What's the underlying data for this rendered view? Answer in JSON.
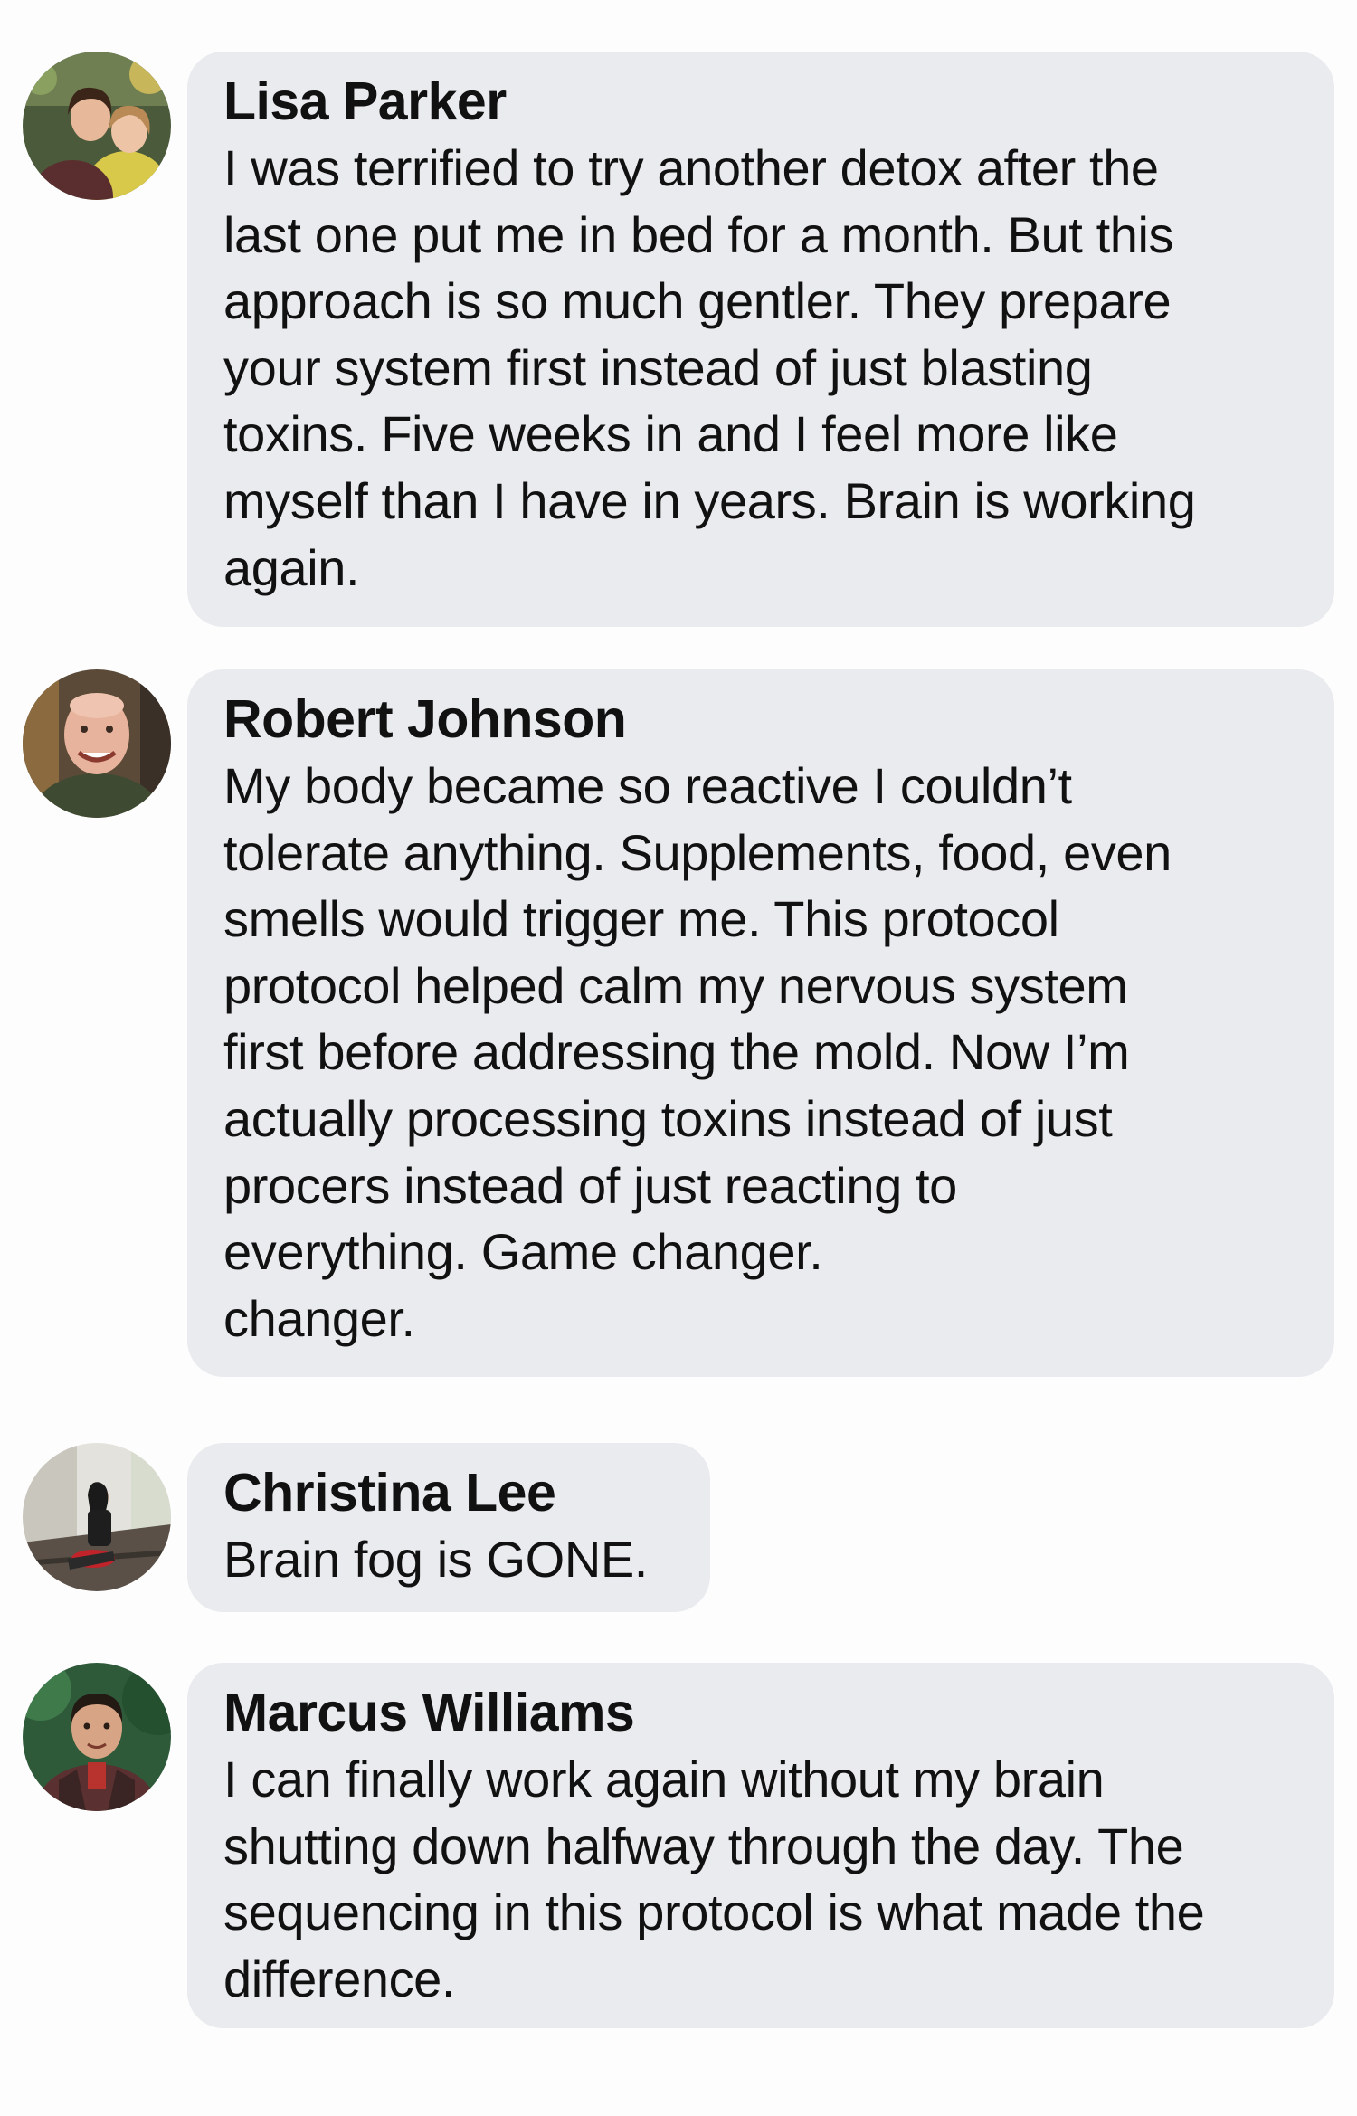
{
  "comments": [
    {
      "author": "Lisa Parker",
      "avatar_icon": "user-photo-avatar",
      "text_lines": [
        "I was terrified to try another detox after the",
        "last one put me in bed for a month. But this",
        "approach is so much gentler. They prepare",
        "your system first instead of just blasting",
        "toxins. Five weeks in and I feel more like",
        "myself than I have in years. Brain is working",
        "again."
      ]
    },
    {
      "author": "Robert Johnson",
      "avatar_icon": "user-photo-avatar",
      "text_lines": [
        "My body became so reactive I couldn’t",
        "tolerate anything. Supplements, food, even",
        "smells would trigger me. This protocol",
        "protocol helped calm my nervous system",
        "first before addressing the mold. Now I’m",
        "actually processing toxins instead of just",
        "procers instead of just reacting to",
        "everything. Game changer.",
        "changer."
      ]
    },
    {
      "author": "Christina Lee",
      "avatar_icon": "user-photo-avatar",
      "text_lines": [
        "Brain fog is GONE."
      ]
    },
    {
      "author": "Marcus Williams",
      "avatar_icon": "user-photo-avatar",
      "text_lines": [
        "I can finally work again without my brain",
        "shutting down halfway through the day. The",
        "sequencing in this protocol is what made the",
        "difference."
      ]
    }
  ]
}
